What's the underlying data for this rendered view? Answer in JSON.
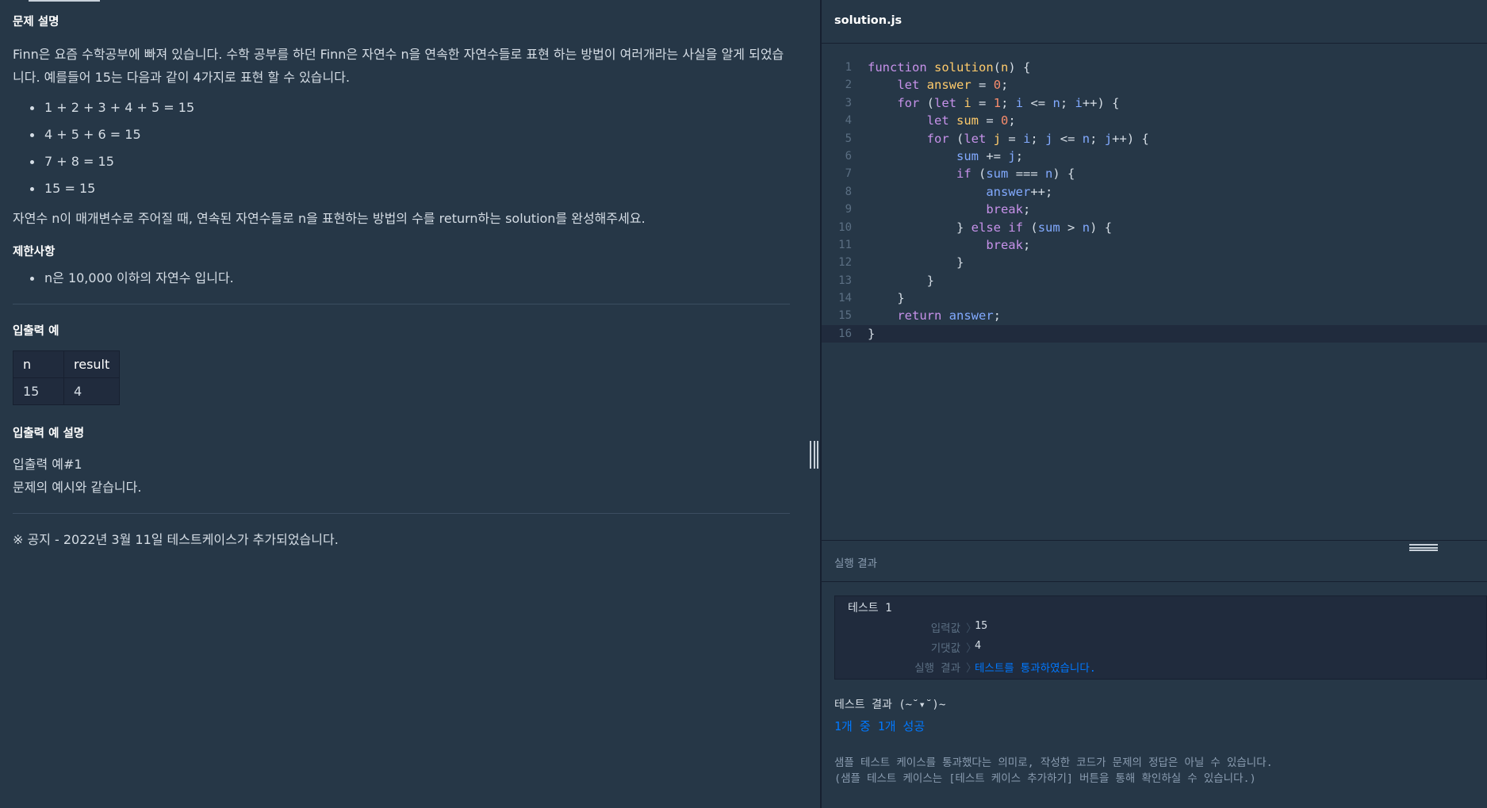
{
  "description": {
    "title": "문제 설명",
    "intro": "Finn은 요즘 수학공부에 빠져 있습니다. 수학 공부를 하던 Finn은 자연수 n을 연속한 자연수들로 표현 하는 방법이 여러개라는 사실을 알게 되었습니다. 예를들어 15는 다음과 같이 4가지로 표현 할 수 있습니다.",
    "examples": [
      "1 + 2 + 3 + 4 + 5 = 15",
      "4 + 5 + 6 = 15",
      "7 + 8 = 15",
      "15 = 15"
    ],
    "task": "자연수 n이 매개변수로 주어질 때, 연속된 자연수들로 n을 표현하는 방법의 수를 return하는 solution를 완성해주세요."
  },
  "constraints": {
    "title": "제한사항",
    "items": [
      "n은 10,000 이하의 자연수 입니다."
    ]
  },
  "io_example": {
    "title": "입출력 예",
    "headers": [
      "n",
      "result"
    ],
    "rows": [
      [
        "15",
        "4"
      ]
    ]
  },
  "io_explanation": {
    "title": "입출력 예 설명",
    "lines": [
      "입출력 예#1",
      "문제의 예시와 같습니다."
    ]
  },
  "notice": "※ 공지 - 2022년 3월 11일 테스트케이스가 추가되었습니다.",
  "editor": {
    "filename": "solution.js",
    "line_numbers": [
      "1",
      "2",
      "3",
      "4",
      "5",
      "6",
      "7",
      "8",
      "9",
      "10",
      "11",
      "12",
      "13",
      "14",
      "15",
      "16"
    ]
  },
  "results": {
    "title": "실행 결과",
    "test": {
      "name": "테스트 1",
      "rows": [
        {
          "label": "입력값",
          "sep": "〉",
          "value": "15"
        },
        {
          "label": "기댓값",
          "sep": "〉",
          "value": "4"
        },
        {
          "label": "실행 결과",
          "sep": "〉",
          "value": "테스트를 통과하였습니다."
        }
      ]
    },
    "summary_title": "테스트 결과 (~˘▾˘)~",
    "summary_count": "1개 중 1개 성공",
    "notes": [
      "샘플 테스트 케이스를 통과했다는 의미로, 작성한 코드가 문제의 정답은 아닐 수 있습니다.",
      "(샘플 테스트 케이스는 [테스트 케이스 추가하기] 버튼을 통해 확인하실 수 있습니다.)"
    ]
  },
  "colors": {
    "background": "#263747",
    "panel_dark": "#202b3d",
    "border": "#172030",
    "keyword": "#c792ea",
    "function": "#ffcb6b",
    "number": "#f78c6c",
    "identifier": "#82aaff",
    "pass": "#0078ff"
  }
}
